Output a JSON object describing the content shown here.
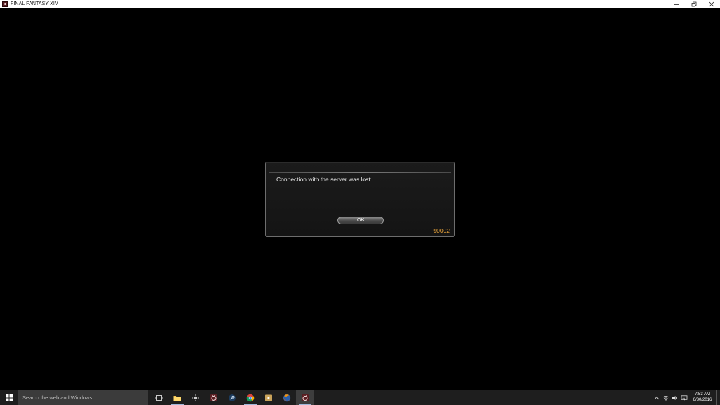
{
  "window": {
    "title": "FINAL FANTASY XIV",
    "icon": "ffxiv-app-icon",
    "controls": [
      "minimize-icon",
      "restore-icon",
      "close-icon"
    ]
  },
  "dialog": {
    "message": "Connection with the server was lost.",
    "ok_label": "OK",
    "error_code": "90002",
    "error_code_color": "#e8a33a"
  },
  "taskbar": {
    "search_placeholder": "Search the web and Windows",
    "pinned": [
      {
        "icon": "task-view-icon",
        "running": false
      },
      {
        "icon": "file-explorer-icon",
        "running": true
      },
      {
        "icon": "game-app-icon",
        "running": false
      },
      {
        "icon": "ffxiv-launcher-icon",
        "running": false
      },
      {
        "icon": "steam-icon",
        "running": false
      },
      {
        "icon": "chrome-icon",
        "running": true
      },
      {
        "icon": "media-player-icon",
        "running": false
      },
      {
        "icon": "firefox-icon",
        "running": false
      },
      {
        "icon": "ffxiv-game-icon",
        "running": true,
        "active": true
      }
    ],
    "clock": {
      "time": "7:53 AM",
      "date": "6/30/2016"
    }
  }
}
